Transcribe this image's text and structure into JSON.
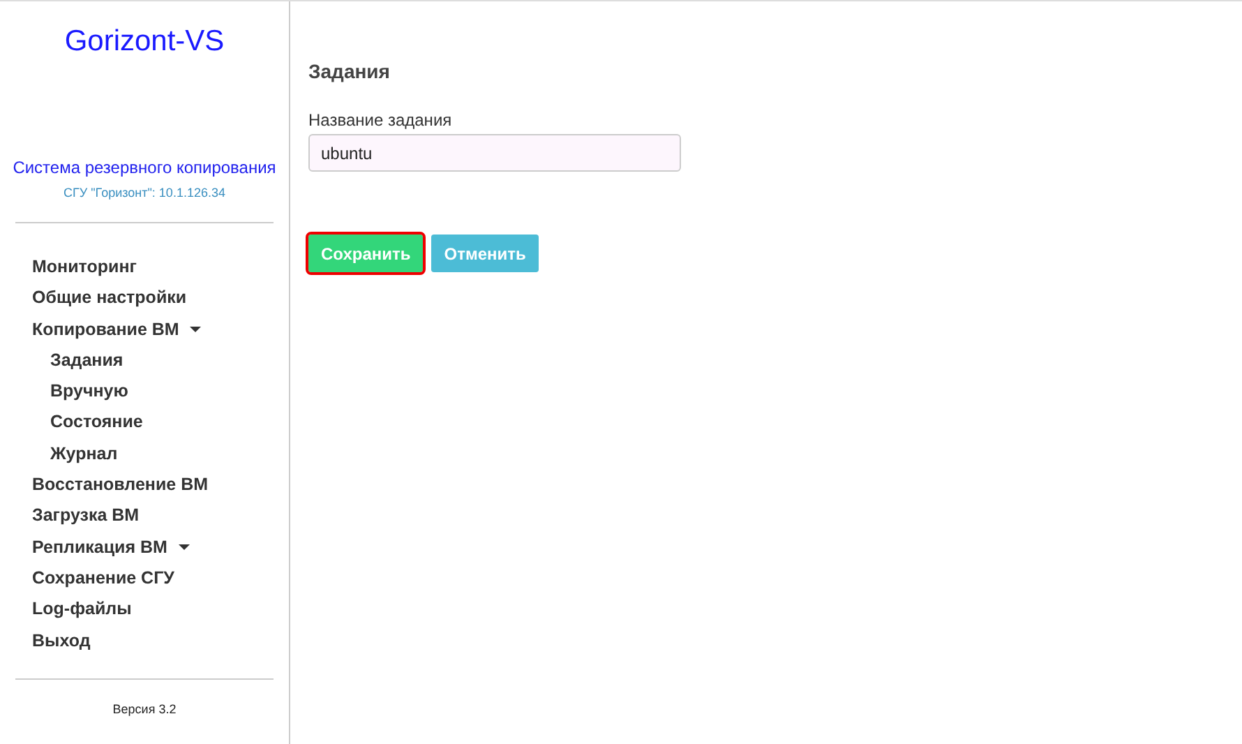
{
  "sidebar": {
    "logo": "Gorizont-VS",
    "subtitle": "Система резервного копирования",
    "server": "СГУ \"Горизонт\": 10.1.126.34",
    "items": [
      {
        "label": "Мониторинг",
        "kind": "link"
      },
      {
        "label": "Общие настройки",
        "kind": "link"
      },
      {
        "label": "Копирование ВМ",
        "kind": "dropdown",
        "children": [
          {
            "label": "Задания"
          },
          {
            "label": "Вручную"
          },
          {
            "label": "Состояние"
          },
          {
            "label": "Журнал"
          }
        ]
      },
      {
        "label": "Восстановление ВМ",
        "kind": "link"
      },
      {
        "label": "Загрузка ВМ",
        "kind": "link"
      },
      {
        "label": "Репликация ВМ",
        "kind": "dropdown"
      },
      {
        "label": "Сохранение СГУ",
        "kind": "link"
      },
      {
        "label": "Log-файлы",
        "kind": "link"
      },
      {
        "label": "Выход",
        "kind": "link"
      }
    ],
    "version": "Версия 3.2"
  },
  "main": {
    "heading": "Задания",
    "field": {
      "label": "Название задания",
      "value": "ubuntu"
    },
    "buttons": [
      {
        "label": "Сохранить",
        "kind": "save",
        "focused": true
      },
      {
        "label": "Отменить",
        "kind": "cancel",
        "focused": false
      }
    ]
  }
}
